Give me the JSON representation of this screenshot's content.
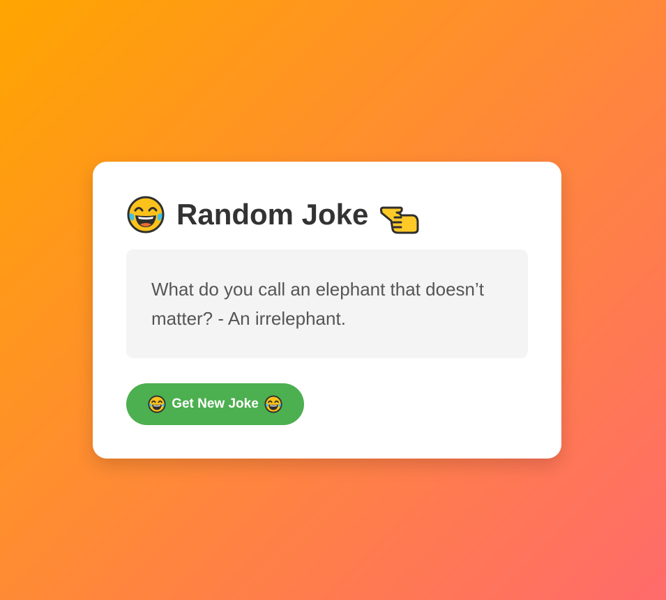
{
  "card": {
    "title": "Random Joke",
    "title_left_icon": "laughing-tears-emoji-icon",
    "title_right_icon": "pointing-left-hand-emoji-icon"
  },
  "joke": {
    "text": "What do you call an elephant that doesn’t matter? - An irrelephant."
  },
  "button": {
    "label": "Get New Joke",
    "icon": "laughing-tears-emoji-icon",
    "color": "#4caf50"
  },
  "colors": {
    "background_start": "#ffa500",
    "background_end": "#ff6b6b",
    "card": "#ffffff",
    "joke_box": "#f4f4f4"
  }
}
